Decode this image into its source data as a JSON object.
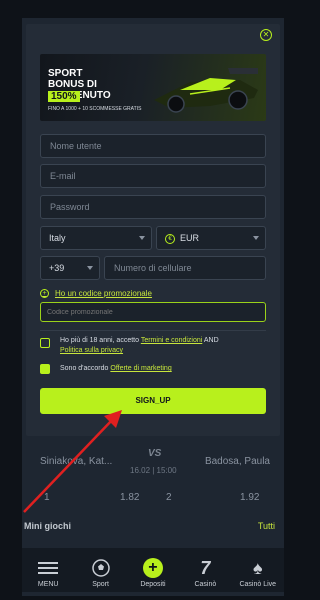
{
  "banner": {
    "title_line1": "SPORT",
    "title_line2": "BONUS DI BENVENUTO",
    "percent": "150%",
    "subtitle": "FINO A 1000 + 10 SCOMMESSE GRATIS"
  },
  "form": {
    "username_placeholder": "Nome utente",
    "email_placeholder": "E-mail",
    "password_placeholder": "Password",
    "country_value": "Italy",
    "currency_value": "EUR",
    "phone_prefix": "+39",
    "phone_placeholder": "Numero di cellulare",
    "promo_toggle_label": "Ho un codice promozionale",
    "promo_placeholder": "Codice promozionale",
    "age_text_prefix": "Ho più di 18 anni, accetto ",
    "terms_link": "Termini e condizioni",
    "age_text_mid": " AND",
    "privacy_link": "Politica sulla privacy",
    "marketing_text_prefix": "Sono d'accordo ",
    "marketing_link": "Offerte di marketing",
    "age_checked": false,
    "marketing_checked": true,
    "submit_label": "SIGN_UP"
  },
  "background": {
    "team_left": "Siniakova, Kat...",
    "team_right": "Badosa, Paula",
    "vs": "VS",
    "date": "16.02 | 15:00",
    "odds": [
      "1",
      "1.82",
      "2",
      "1.92"
    ],
    "section_title": "Mini giochi",
    "section_link": "Tutti"
  },
  "nav": [
    {
      "label": "MENU",
      "icon": "menu-icon"
    },
    {
      "label": "Sport",
      "icon": "soccer-ball-icon"
    },
    {
      "label": "Depositi",
      "icon": "plus-icon"
    },
    {
      "label": "Casinò",
      "icon": "seven-icon"
    },
    {
      "label": "Casinò Live",
      "icon": "spade-icon"
    }
  ],
  "colors": {
    "accent": "#b8f01c",
    "modal_bg": "#242c37",
    "field_bg": "#1b222b",
    "annotation_arrow": "#e02020"
  }
}
